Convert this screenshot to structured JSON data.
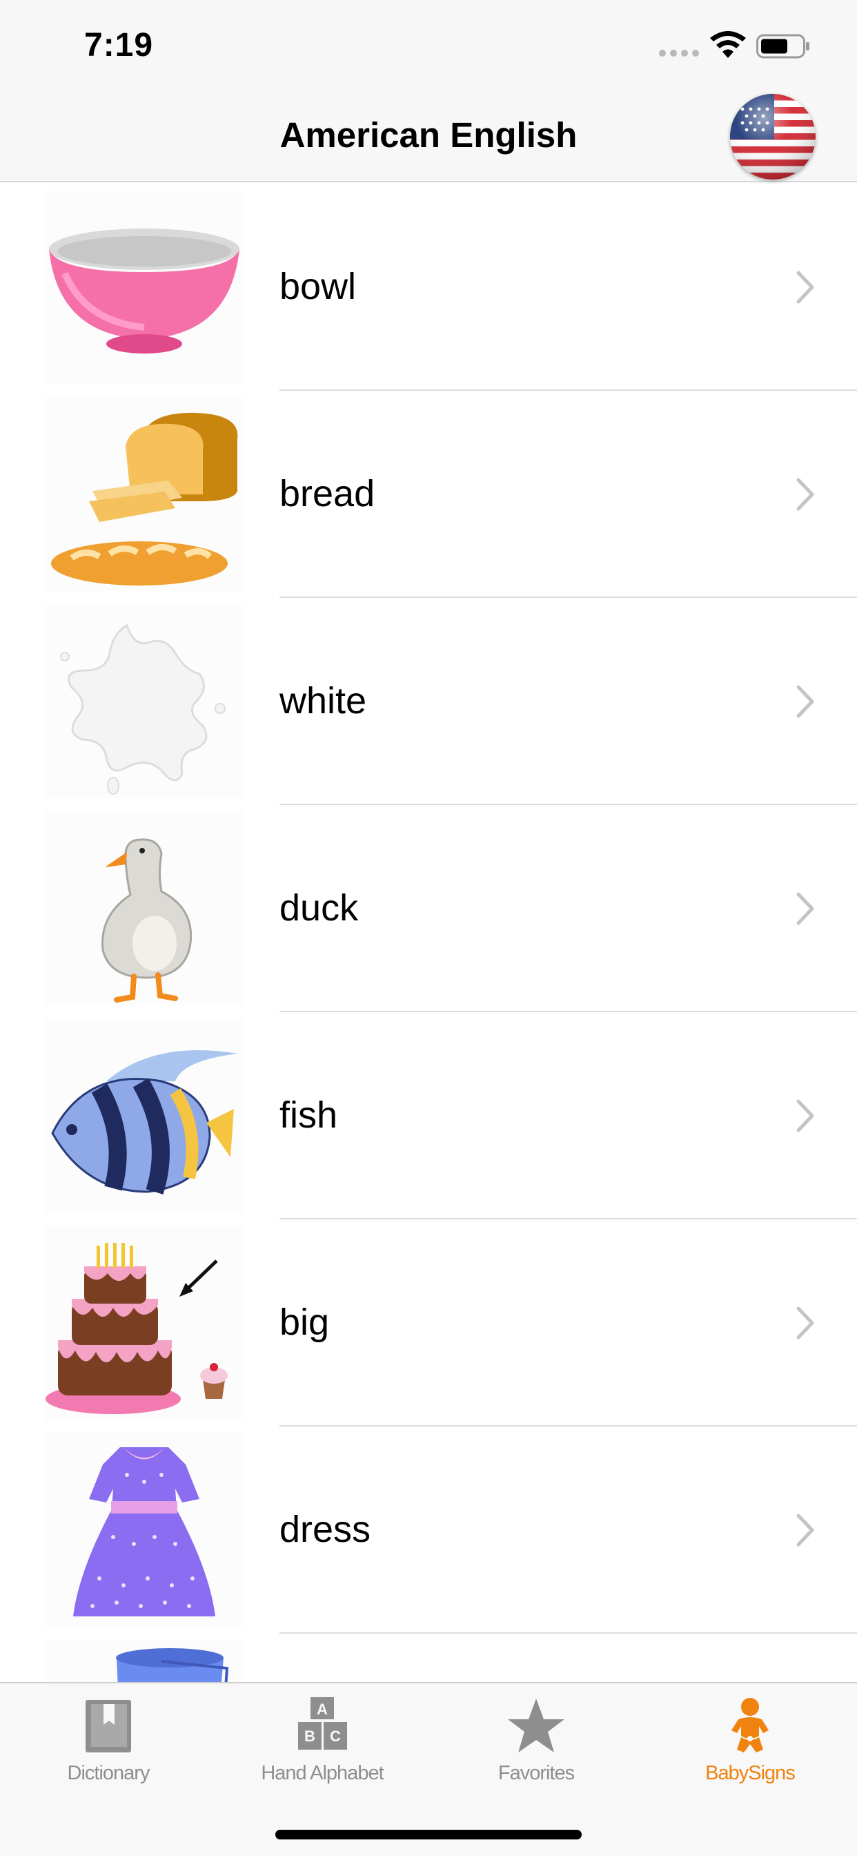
{
  "status_bar": {
    "time": "7:19"
  },
  "nav": {
    "title": "American English",
    "flag": "us-flag-icon"
  },
  "list": {
    "items": [
      {
        "label": "bowl",
        "image": "bowl-image"
      },
      {
        "label": "bread",
        "image": "bread-image"
      },
      {
        "label": "white",
        "image": "milk-splash-image"
      },
      {
        "label": "duck",
        "image": "duck-image"
      },
      {
        "label": "fish",
        "image": "fish-image"
      },
      {
        "label": "big",
        "image": "cake-image"
      },
      {
        "label": "dress",
        "image": "dress-image"
      }
    ]
  },
  "tabs": [
    {
      "label": "Dictionary",
      "icon": "dictionary-book-icon",
      "active": false
    },
    {
      "label": "Hand Alphabet",
      "icon": "alphabet-blocks-icon",
      "active": false
    },
    {
      "label": "Favorites",
      "icon": "star-icon",
      "active": false
    },
    {
      "label": "BabySigns",
      "icon": "baby-icon",
      "active": true
    }
  ],
  "colors": {
    "accent": "#f0820f",
    "inactive_tab": "#8e8e8e",
    "separator": "#dcdcdc",
    "bar_background": "#f7f7f7"
  }
}
